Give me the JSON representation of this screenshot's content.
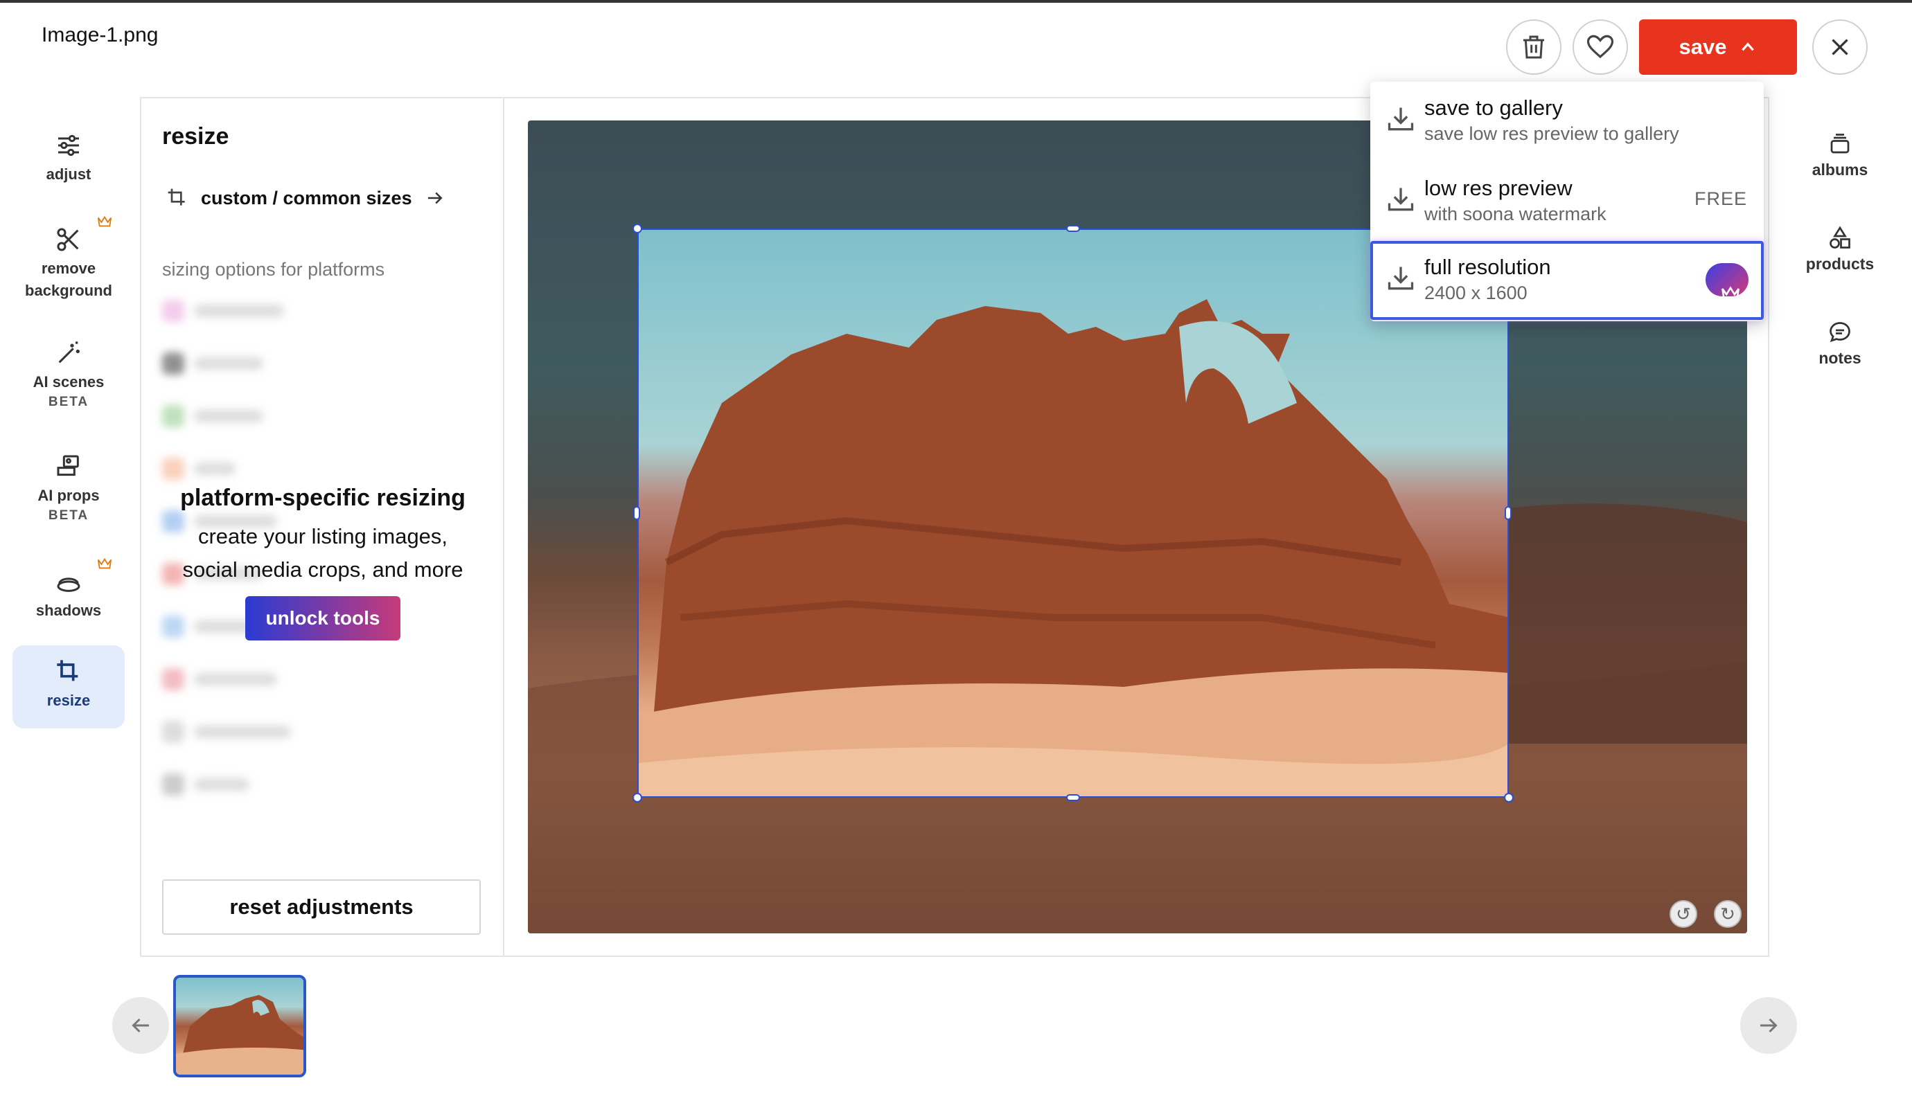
{
  "window": {
    "filename": "Image-1.png"
  },
  "left_tools": [
    {
      "label": "adjust"
    },
    {
      "label": "remove background",
      "line1": "remove",
      "line2": "background",
      "premium": true
    },
    {
      "label": "AI scenes",
      "beta": "BETA"
    },
    {
      "label": "AI props",
      "beta": "BETA"
    },
    {
      "label": "shadows",
      "premium": true
    },
    {
      "label": "resize",
      "active": true
    }
  ],
  "panel": {
    "title": "resize",
    "sizes_link": "custom / common sizes",
    "platforms_label": "sizing options for platforms",
    "promo": {
      "title": "platform-specific resizing",
      "text_line1": "create your listing images,",
      "text_line2": "social media crops, and more",
      "button": "unlock tools"
    },
    "reset_button": "reset adjustments"
  },
  "right_rail": [
    {
      "label": "albums"
    },
    {
      "label": "products"
    },
    {
      "label": "notes"
    }
  ],
  "toolbar": {
    "save_label": "save"
  },
  "save_menu": [
    {
      "title": "save to gallery",
      "subtitle": "save low res preview to gallery"
    },
    {
      "title": "low res preview",
      "subtitle": "with soona watermark",
      "badge": "FREE"
    },
    {
      "title": "full resolution",
      "subtitle": "2400 x 1600",
      "premium": true
    }
  ],
  "colors": {
    "accent_red": "#e8331f",
    "selection_blue": "#2a4fd6",
    "active_tool_bg": "#e2ecfb"
  }
}
